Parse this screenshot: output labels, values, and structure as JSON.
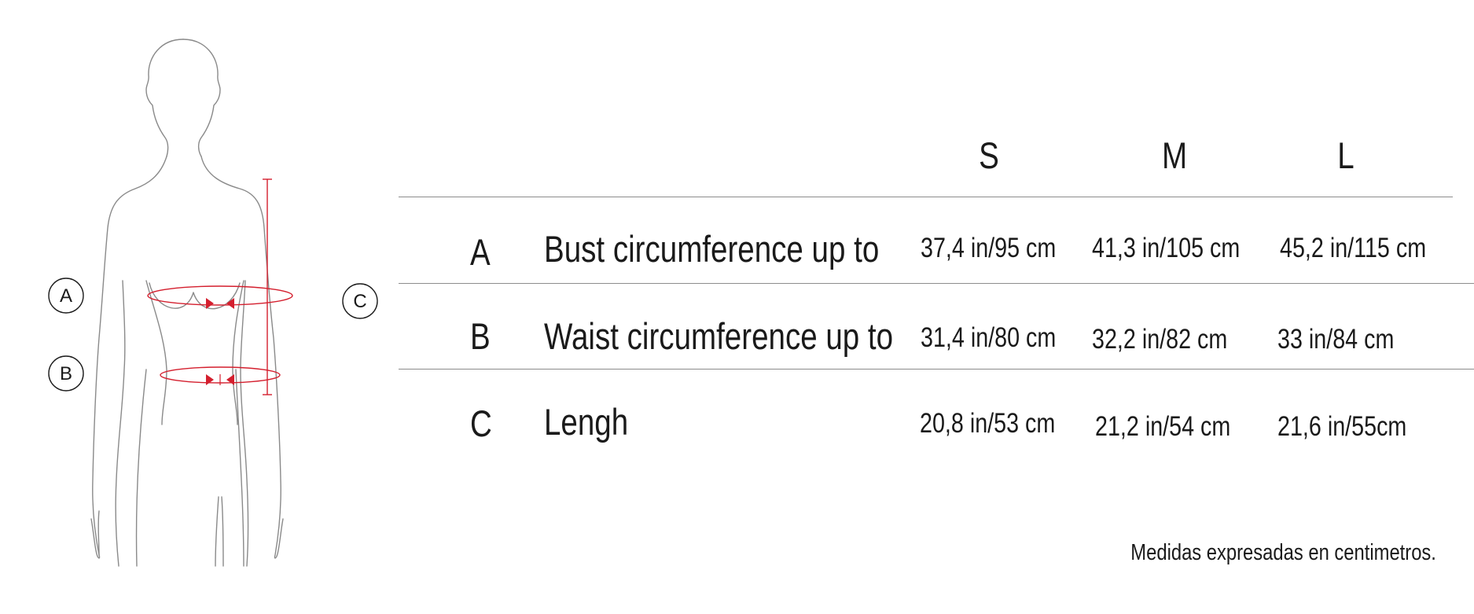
{
  "diagram": {
    "markers": [
      {
        "id": "A",
        "label": "A"
      },
      {
        "id": "B",
        "label": "B"
      },
      {
        "id": "C",
        "label": "C"
      }
    ],
    "line_color": "#8a8a8a",
    "accent_color": "#d41f2e"
  },
  "table": {
    "sizes": [
      "S",
      "M",
      "L"
    ],
    "rows": [
      {
        "letter": "A",
        "label": "Bust circumference up to",
        "values": [
          "37,4 in/95 cm",
          "41,3 in/105 cm",
          "45,2 in/115 cm"
        ]
      },
      {
        "letter": "B",
        "label": "Waist circumference up to",
        "values": [
          "31,4 in/80 cm",
          "32,2 in/82 cm",
          "33 in/84 cm"
        ]
      },
      {
        "letter": "C",
        "label": "Lengh",
        "values": [
          "20,8 in/53 cm",
          "21,2 in/54 cm",
          "21,6 in/55cm"
        ]
      }
    ]
  },
  "footnote": "Medidas expresadas en centimetros."
}
